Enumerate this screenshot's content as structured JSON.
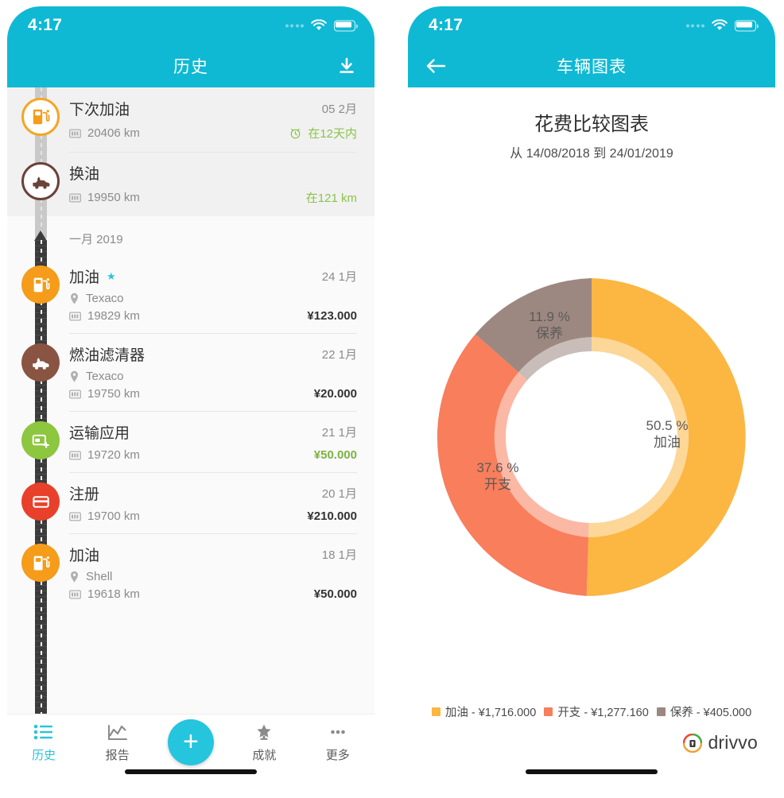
{
  "status": {
    "time": "4:17"
  },
  "left_screen": {
    "appbar": {
      "title": "历史",
      "download_icon": "download-icon"
    },
    "upcoming": [
      {
        "icon": "fuel-pump-icon",
        "title": "下次加油",
        "date": "05 2月",
        "odometer": "20406 km",
        "status": "在12天内",
        "status_color": "#8bc34a"
      },
      {
        "icon": "oil-change-icon",
        "title": "换油",
        "date": "",
        "odometer": "19950 km",
        "status": "在121 km",
        "status_color": "#8bc34a"
      }
    ],
    "month_header": "一月 2019",
    "entries": [
      {
        "icon": "fuel-pump-icon",
        "title": "加油",
        "starred": true,
        "date": "24 1月",
        "place": "Texaco",
        "odometer": "19829 km",
        "amount": "¥123.000",
        "amount_color": "#333333",
        "icon_color": "#f59c1a"
      },
      {
        "icon": "oil-filter-icon",
        "title": "燃油滤清器",
        "starred": false,
        "date": "22 1月",
        "place": "Texaco",
        "odometer": "19750 km",
        "amount": "¥20.000",
        "amount_color": "#333333",
        "icon_color": "#8a5442"
      },
      {
        "icon": "expense-card-icon",
        "title": "运输应用",
        "starred": false,
        "date": "21 1月",
        "place": "",
        "odometer": "19720 km",
        "amount": "¥50.000",
        "amount_color": "#8bc34a",
        "icon_color": "#8dc63f"
      },
      {
        "icon": "registration-card-icon",
        "title": "注册",
        "starred": false,
        "date": "20 1月",
        "place": "",
        "odometer": "19700 km",
        "amount": "¥210.000",
        "amount_color": "#333333",
        "icon_color": "#e8402a"
      },
      {
        "icon": "fuel-pump-icon",
        "title": "加油",
        "starred": false,
        "date": "18 1月",
        "place": "Shell",
        "odometer": "19618 km",
        "amount": "¥50.000",
        "amount_color": "#333333",
        "icon_color": "#f59c1a"
      }
    ],
    "bottom_nav": {
      "items": [
        {
          "label": "历史",
          "icon": "list-icon",
          "active": true
        },
        {
          "label": "报告",
          "icon": "chart-line-icon",
          "active": false
        },
        {
          "label": "成就",
          "icon": "star-trophy-icon",
          "active": false
        },
        {
          "label": "更多",
          "icon": "more-dots-icon",
          "active": false
        }
      ],
      "fab": {
        "icon": "plus-icon",
        "color": "#25c5de"
      }
    }
  },
  "right_screen": {
    "appbar": {
      "title": "车辆图表",
      "back_icon": "arrow-left-icon"
    },
    "chart_title": "花费比较图表",
    "chart_subtitle": "从 14/08/2018 到 24/01/2019",
    "brand": {
      "name": "drivvo",
      "icon": "drivvo-logo-icon"
    }
  },
  "chart_data": {
    "type": "pie",
    "title": "花费比较图表",
    "subtitle": "从 14/08/2018 到 24/01/2019",
    "categories": [
      "加油",
      "开支",
      "保养"
    ],
    "values": [
      1716.0,
      1277.16,
      405.0
    ],
    "percentages": [
      50.5,
      37.6,
      11.9
    ],
    "value_labels": [
      "¥1,716.000",
      "¥1,277.160",
      "¥405.000"
    ],
    "percent_labels": [
      "50.5 %",
      "37.6 %",
      "11.9 %"
    ],
    "colors": [
      "#fcb642",
      "#f87e5c",
      "#9c8880"
    ],
    "inner_ring_colors": [
      "#fdd79a",
      "#fbb7a3",
      "#c4b6b0"
    ],
    "legend_entries": [
      "加油 - ¥1,716.000",
      "开支 - ¥1,277.160",
      "保养 - ¥405.000"
    ],
    "legend_position": "bottom",
    "donut": true,
    "start_angle_deg": 0,
    "ylabel": "",
    "xlabel": "",
    "grid": false
  }
}
